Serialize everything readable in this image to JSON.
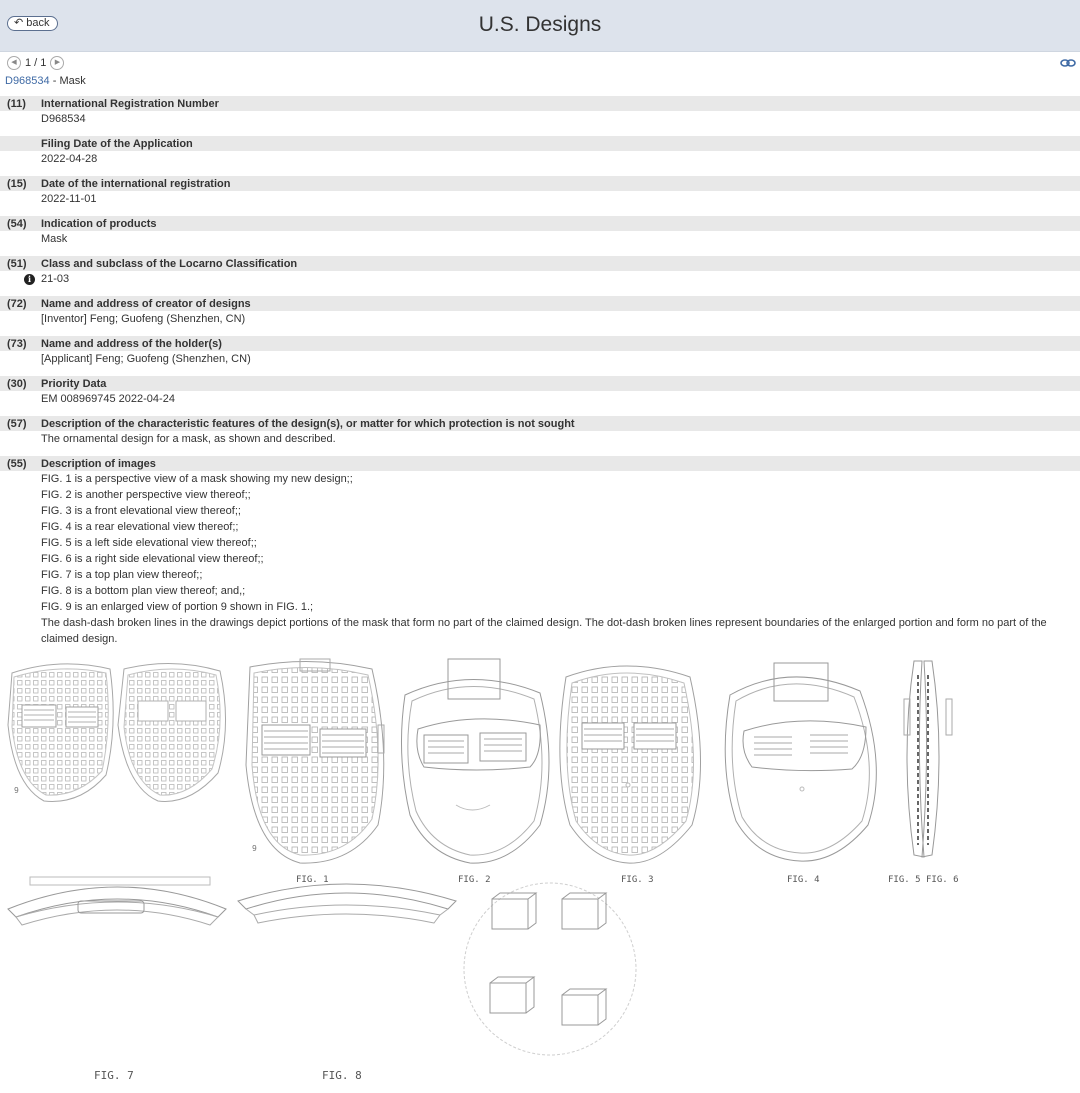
{
  "header": {
    "back_label": "back",
    "title": "U.S. Designs"
  },
  "pager": {
    "text": "1 / 1"
  },
  "document": {
    "number": "D968534",
    "separator": " - ",
    "title": "Mask"
  },
  "fields": [
    {
      "code": "(11)",
      "label": "International Registration Number",
      "value": "D968534"
    },
    {
      "code": "",
      "label": "Filing Date of the Application",
      "value": "2022-04-28"
    },
    {
      "code": "(15)",
      "label": "Date of the international registration",
      "value": "2022-11-01"
    },
    {
      "code": "(54)",
      "label": "Indication of products",
      "value": "Mask"
    },
    {
      "code": "(51)",
      "label": "Class and subclass of the Locarno Classification",
      "value": "21-03"
    },
    {
      "code": "(72)",
      "label": "Name and address of creator of designs",
      "value": "[Inventor] Feng; Guofeng (Shenzhen, CN)"
    },
    {
      "code": "(73)",
      "label": "Name and address of the holder(s)",
      "value": "[Applicant]  Feng; Guofeng (Shenzhen, CN)"
    },
    {
      "code": "(30)",
      "label": "Priority Data",
      "value": "EM 008969745 2022-04-24"
    },
    {
      "code": "(57)",
      "label": "Description of the characteristic features of the design(s), or matter for which protection is not sought",
      "value": "The ornamental design for a mask, as shown and described."
    }
  ],
  "images_section": {
    "code": "(55)",
    "label": "Description of images",
    "lines": [
      "FIG. 1 is a perspective view of a mask showing my new design;;",
      "FIG. 2 is another perspective view thereof;;",
      "FIG. 3 is a front elevational view thereof;;",
      "FIG. 4 is a rear elevational view thereof;;",
      "FIG. 5 is a left side elevational view thereof;;",
      "FIG. 6 is a right side elevational view thereof;;",
      "FIG. 7 is a top plan view thereof;;",
      "FIG. 8 is a bottom plan view thereof; and,;",
      "FIG. 9 is an enlarged view of portion 9 shown in FIG. 1.;"
    ],
    "note": "The dash-dash broken lines in the drawings depict portions of the mask that form no part of the claimed design. The dot-dash broken lines represent boundaries of the enlarged portion and form no part of the claimed design."
  },
  "figure_labels": {
    "fig1": "FIG. 1",
    "fig2": "FIG. 2",
    "fig3": "FIG. 3",
    "fig4": "FIG. 4",
    "fig5": "FIG. 5",
    "fig6": "FIG. 6",
    "fig7": "FIG. 7",
    "fig8": "FIG. 8",
    "ref9a": "9",
    "ref9b": "9"
  },
  "colors": {
    "header_bg": "#dde3ec",
    "field_bg": "#e8e8e8",
    "link": "#3f6aa5",
    "drawing_line": "#9a9a9a"
  },
  "icons": {
    "back": "back-arrow-icon",
    "prev": "chevron-left-icon",
    "next": "chevron-right-icon",
    "link": "link-icon",
    "info": "info-icon"
  }
}
